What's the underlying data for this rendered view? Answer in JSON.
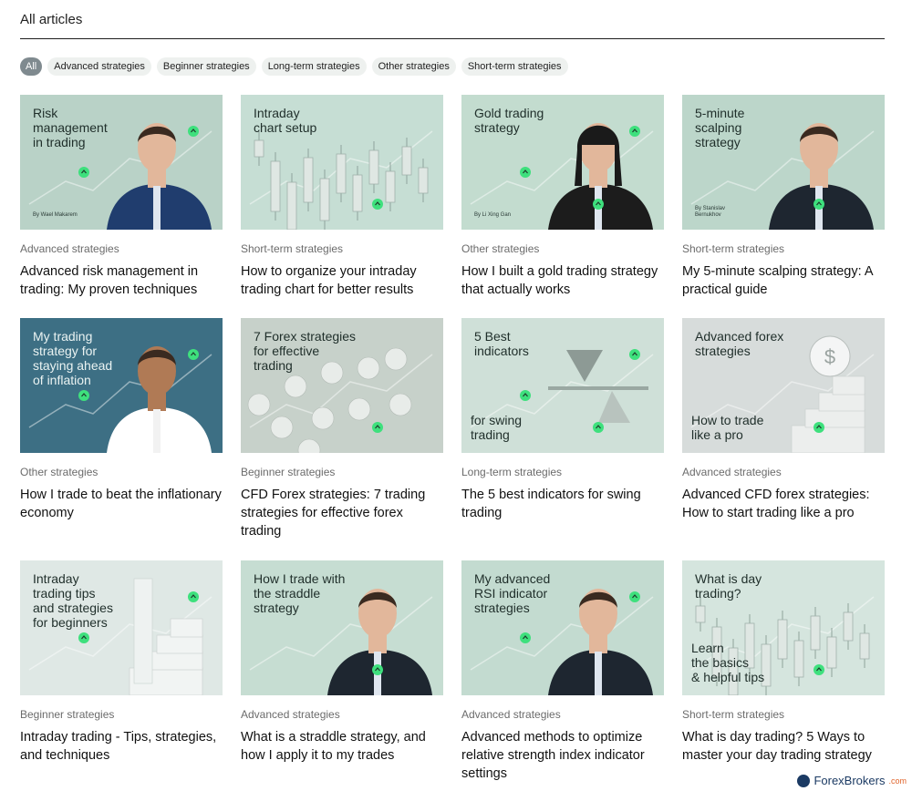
{
  "page": {
    "title": "All articles"
  },
  "filters": [
    {
      "label": "All",
      "active": true
    },
    {
      "label": "Advanced strategies"
    },
    {
      "label": "Beginner strategies"
    },
    {
      "label": "Long-term strategies"
    },
    {
      "label": "Other strategies"
    },
    {
      "label": "Short-term strategies"
    }
  ],
  "articles": [
    {
      "category": "Advanced strategies",
      "title": "Advanced risk management in trading: My proven techniques",
      "thumb_caption": "Risk\nmanagement\nin trading",
      "byline": "By Wael Makarem",
      "theme": "person",
      "bg": "#b9d2c7"
    },
    {
      "category": "Short-term strategies",
      "title": "How to organize your intraday trading chart for better results",
      "thumb_caption": "Intraday\nchart setup",
      "theme": "candles",
      "bg": "#c6ded4"
    },
    {
      "category": "Other strategies",
      "title": "How I built a gold trading strategy that actually works",
      "thumb_caption": "Gold trading\nstrategy",
      "byline": "By Li Xing Gan",
      "theme": "person-f",
      "bg": "#c3dccf"
    },
    {
      "category": "Short-term strategies",
      "title": "My 5-minute scalping strategy: A practical guide",
      "thumb_caption": "5-minute\nscalping\nstrategy",
      "byline": "By Stanislav\nBernukhov",
      "theme": "person",
      "bg": "#bcd6ca"
    },
    {
      "category": "Other strategies",
      "title": "How I trade to beat the inflationary economy",
      "thumb_caption": "My trading\nstrategy for\nstaying ahead\nof inflation",
      "theme": "person-dark",
      "bg": "#3d6f84"
    },
    {
      "category": "Beginner strategies",
      "title": "CFD Forex strategies: 7 trading strategies for effective forex trading",
      "thumb_caption": "7 Forex strategies\nfor effective\ntrading",
      "theme": "spheres",
      "bg": "#c7d1ca"
    },
    {
      "category": "Long-term strategies",
      "title": "The 5 best indicators for swing trading",
      "thumb_caption": "5 Best\nindicators",
      "thumb_caption2": "for swing\ntrading",
      "theme": "scale",
      "bg": "#cfe0d8"
    },
    {
      "category": "Advanced strategies",
      "title": "Advanced CFD forex strategies: How to start trading like a pro",
      "thumb_caption": "Advanced forex\nstrategies",
      "thumb_caption2": "How to trade\nlike a pro",
      "theme": "stairs",
      "bg": "#d7dcdb"
    },
    {
      "category": "Beginner strategies",
      "title": "Intraday trading - Tips, strategies, and techniques",
      "thumb_caption": "Intraday\ntrading tips\nand strategies\nfor beginners",
      "theme": "stairs-light",
      "bg": "#dfe8e5"
    },
    {
      "category": "Advanced strategies",
      "title": "What is a straddle strategy, and how I apply it to my trades",
      "thumb_caption": "How I trade with\nthe straddle\nstrategy",
      "theme": "person",
      "bg": "#c6ddd2"
    },
    {
      "category": "Advanced strategies",
      "title": "Advanced methods to optimize relative strength index indicator settings",
      "thumb_caption": "My advanced\nRSI indicator\nstrategies",
      "theme": "person",
      "bg": "#c3dbd0"
    },
    {
      "category": "Short-term strategies",
      "title": "What is day trading? 5 Ways to master your day trading strategy",
      "thumb_caption": "What is day\ntrading?",
      "thumb_caption2": "Learn\nthe basics\n& helpful tips",
      "theme": "candles",
      "bg": "#d5e5de"
    }
  ],
  "watermark": {
    "text": "ForexBrokers",
    "suffix": ".com"
  },
  "colors": {
    "accent": "#3ee07d",
    "chip_bg": "#eef1ef",
    "chip_active": "#7f8a8f"
  }
}
